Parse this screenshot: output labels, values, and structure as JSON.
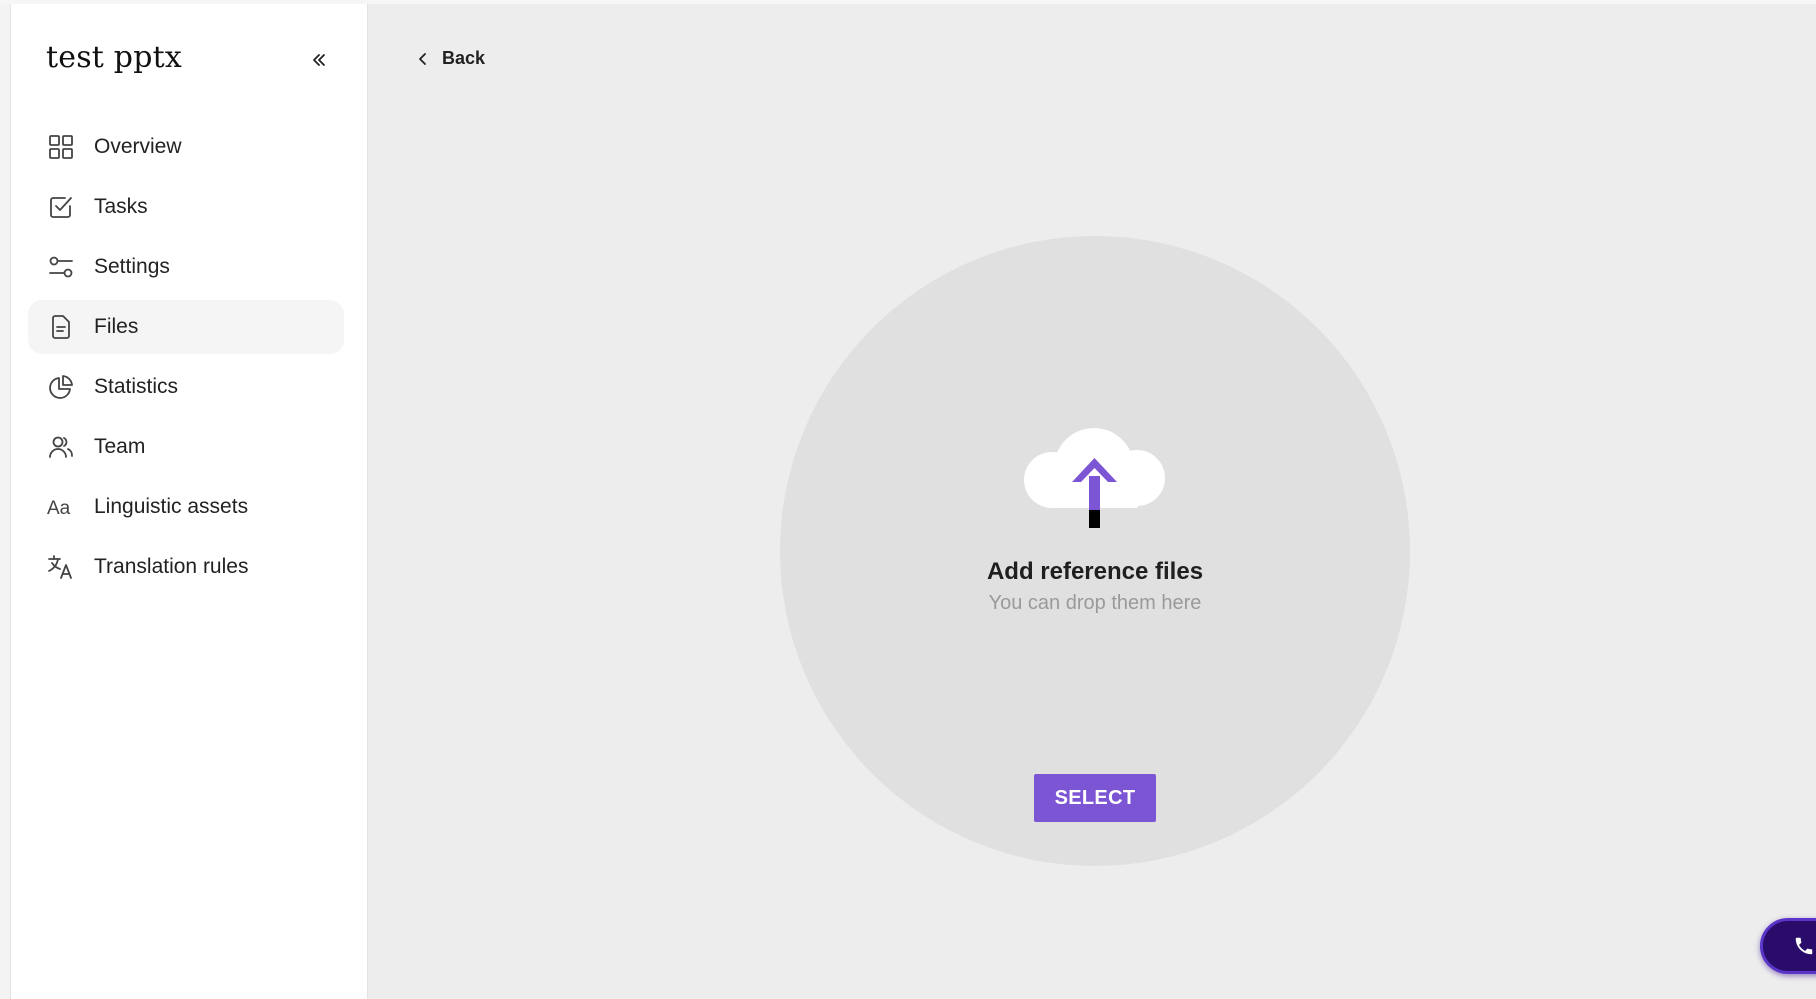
{
  "project": {
    "title": "test pptx"
  },
  "sidebar": {
    "collapse_icon": "double-chevron-left-icon",
    "items": [
      {
        "label": "Overview",
        "icon": "grid-icon",
        "active": false
      },
      {
        "label": "Tasks",
        "icon": "checkbox-icon",
        "active": false
      },
      {
        "label": "Settings",
        "icon": "sliders-icon",
        "active": false
      },
      {
        "label": "Files",
        "icon": "file-icon",
        "active": true
      },
      {
        "label": "Statistics",
        "icon": "pie-chart-icon",
        "active": false
      },
      {
        "label": "Team",
        "icon": "users-icon",
        "active": false
      },
      {
        "label": "Linguistic assets",
        "icon": "font-aa-icon",
        "active": false
      },
      {
        "label": "Translation rules",
        "icon": "translate-icon",
        "active": false
      }
    ]
  },
  "header": {
    "back_label": "Back"
  },
  "dropzone": {
    "title": "Add reference files",
    "subtitle": "You can drop them here",
    "button_label": "SELECT",
    "icon": "cloud-upload-icon"
  },
  "colors": {
    "accent": "#7c55d4",
    "background": "#ededed",
    "dropzone": "#e0e0e0",
    "call_button": "#2a0d6b"
  },
  "call_button": {
    "icon": "phone-icon"
  }
}
